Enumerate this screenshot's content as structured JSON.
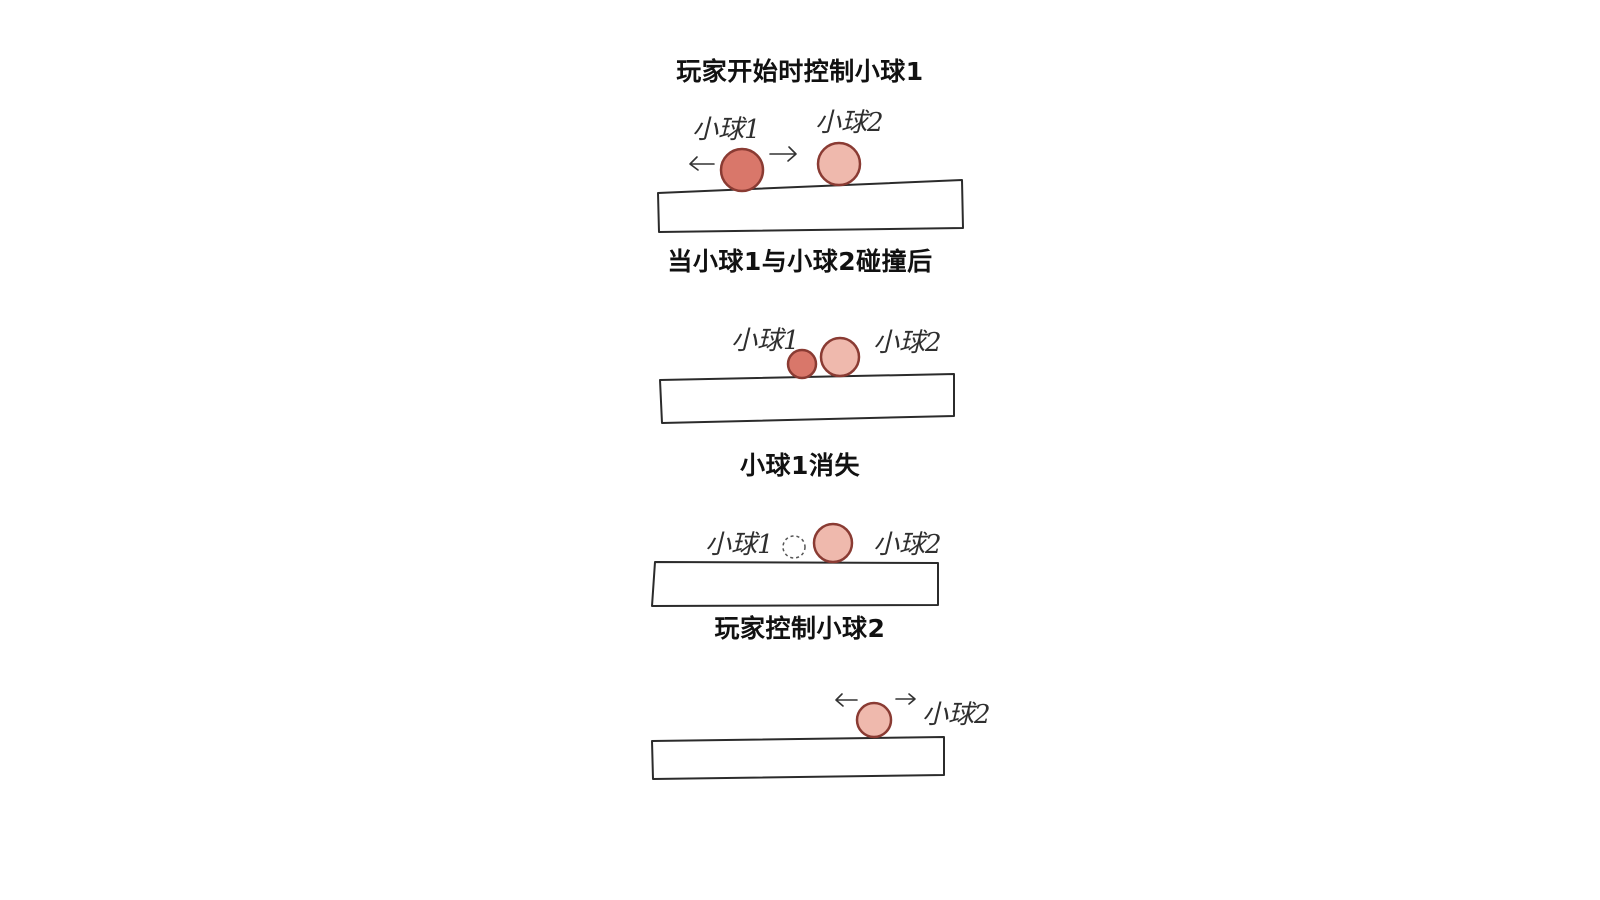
{
  "panels": [
    {
      "caption": "玩家开始时控制小球1",
      "label_ball1": "小球1",
      "label_ball2": "小球2"
    },
    {
      "caption": "当小球1与小球2碰撞后",
      "label_ball1": "小球1",
      "label_ball2": "小球2"
    },
    {
      "caption": "小球1消失",
      "label_ball1": "小球1",
      "label_ball2": "小球2"
    },
    {
      "caption": "玩家控制小球2",
      "label_ball2": "小球2"
    }
  ],
  "colors": {
    "ball1_fill": "#d9776a",
    "ball2_fill": "#efb9ad",
    "ball_outline": "#8a3b33",
    "line": "#2b2b2b",
    "background": "#ffffff"
  }
}
